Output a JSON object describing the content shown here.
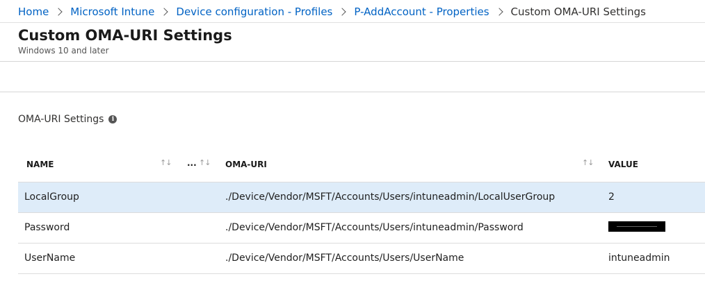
{
  "breadcrumb": {
    "items": [
      "Home",
      "Microsoft Intune",
      "Device configuration - Profiles",
      "P-AddAccount - Properties"
    ],
    "current": "Custom OMA-URI Settings"
  },
  "header": {
    "title": "Custom OMA-URI Settings",
    "subtitle": "Windows 10 and later"
  },
  "section": {
    "label": "OMA-URI Settings",
    "info_icon": "info-icon"
  },
  "table": {
    "columns": {
      "name": "NAME",
      "more": "...",
      "oma_uri": "OMA-URI",
      "value": "VALUE"
    },
    "sort_glyph": "↑↓",
    "rows": [
      {
        "name": "LocalGroup",
        "oma_uri": "./Device/Vendor/MSFT/Accounts/Users/intuneadmin/LocalUserGroup",
        "value": "2",
        "selected": true
      },
      {
        "name": "Password",
        "oma_uri": "./Device/Vendor/MSFT/Accounts/Users/intuneadmin/Password",
        "value": "",
        "masked": true
      },
      {
        "name": "UserName",
        "oma_uri": "./Device/Vendor/MSFT/Accounts/Users/UserName",
        "value": "intuneadmin"
      }
    ]
  },
  "colors": {
    "link": "#0062c4",
    "selected_row": "#deecf9"
  }
}
